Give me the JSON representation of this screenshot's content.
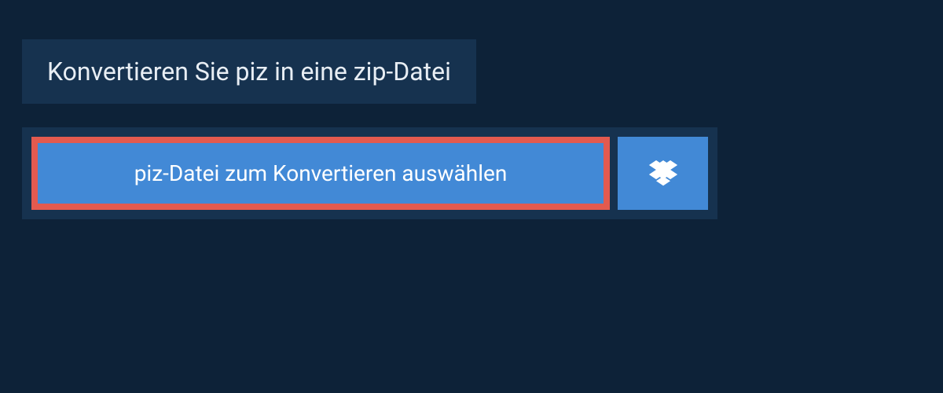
{
  "header": {
    "title": "Konvertieren Sie piz in eine zip-Datei"
  },
  "upload": {
    "select_file_label": "piz-Datei zum Konvertieren auswählen"
  }
}
